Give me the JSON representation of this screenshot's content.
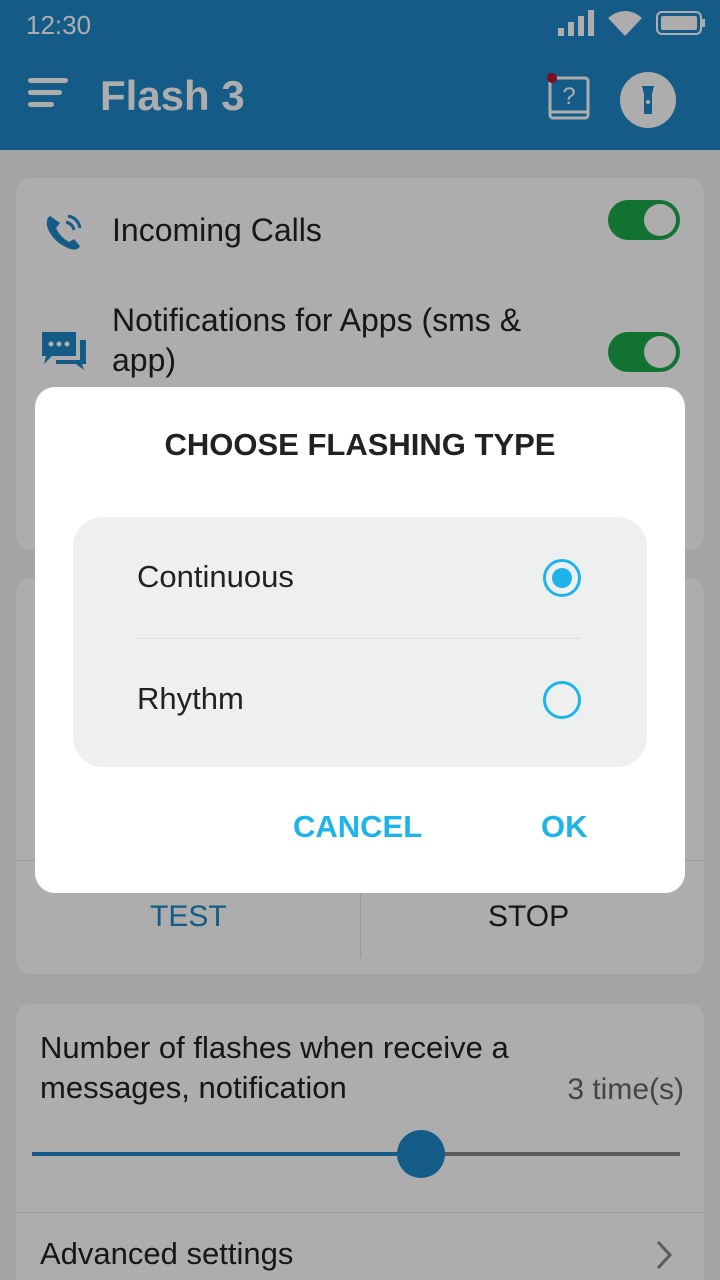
{
  "status_bar": {
    "time": "12:30"
  },
  "app_bar": {
    "title": "Flash 3"
  },
  "settings": {
    "incoming_calls": "Incoming Calls",
    "notifications_apps": "Notifications for Apps (sms & app)",
    "test_label": "TEST",
    "stop_label": "STOP",
    "flashes_label": "Number of flashes when receive a messages, notification",
    "flashes_value": "3 time(s)",
    "flashes_slider_fraction": 0.6,
    "advanced_settings": "Advanced settings"
  },
  "dialog": {
    "title": "CHOOSE FLASHING TYPE",
    "options": [
      {
        "label": "Continuous",
        "selected": true
      },
      {
        "label": "Rhythm",
        "selected": false
      }
    ],
    "cancel_label": "CANCEL",
    "ok_label": "OK"
  },
  "colors": {
    "primary": "#1e88c8",
    "accent": "#1eb4ea",
    "toggle_on": "#1aa84b"
  }
}
